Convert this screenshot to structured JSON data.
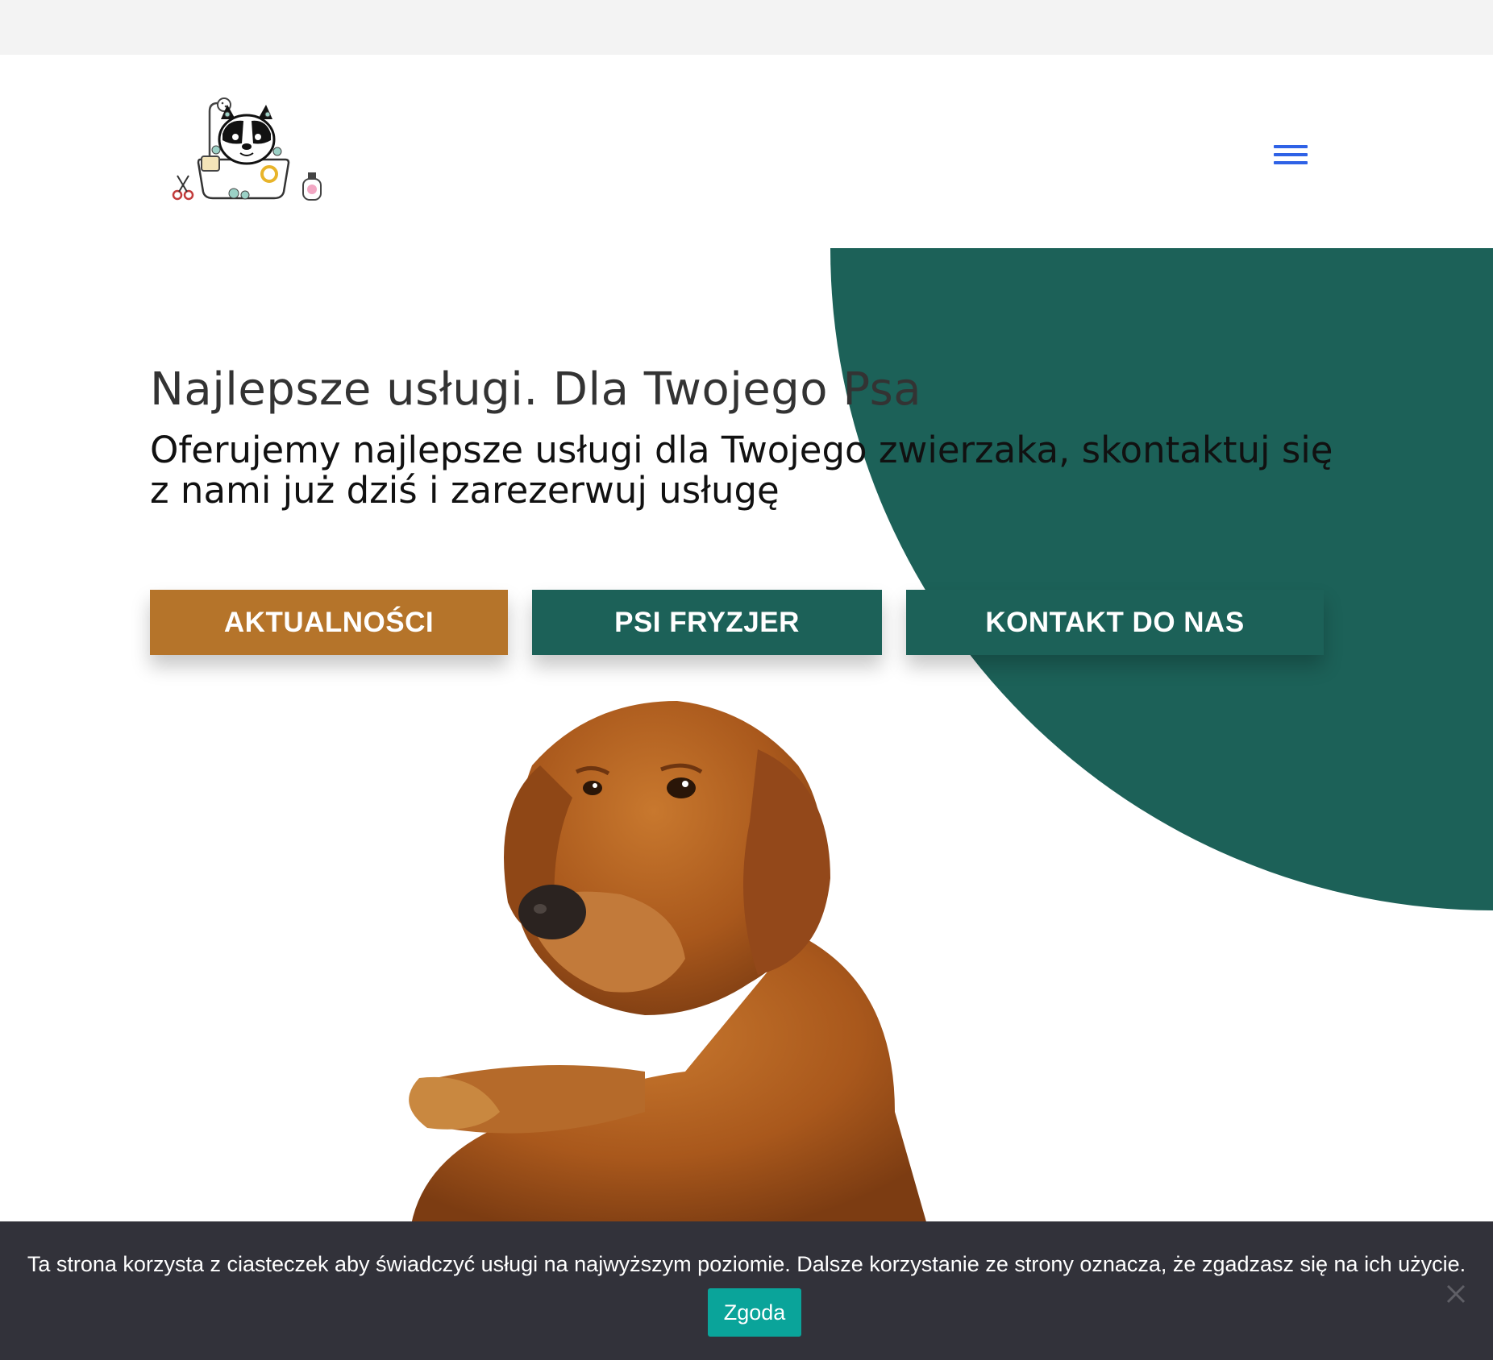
{
  "header": {
    "logo_icon": "dog-bath-grooming-logo",
    "menu_icon": "hamburger-menu-icon",
    "menu_color": "#2f62e6"
  },
  "hero": {
    "title": "Najlepsze usługi. Dla Twojego Psa",
    "subtitle": "Oferujemy najlepsze usługi dla Twojego zwierzaka, skontaktuj się z nami już dziś i zarezerwuj usługę",
    "accent_color": "#1c6158",
    "buttons": [
      {
        "label": "AKTUALNOŚCI",
        "color": "#b5742a"
      },
      {
        "label": "PSI FRYZJER",
        "color": "#1c6158"
      },
      {
        "label": "KONTAKT DO NAS",
        "color": "#1c6158"
      }
    ],
    "image_icon": "golden-retriever-photo"
  },
  "cookie": {
    "text": "Ta strona korzysta z ciasteczek aby świadczyć usługi na najwyższym poziomie. Dalsze korzystanie ze strony oznacza, że zgadzasz się na ich użycie.",
    "accept_label": "Zgoda",
    "accept_color": "#0aa49a",
    "close_icon": "close-icon"
  }
}
